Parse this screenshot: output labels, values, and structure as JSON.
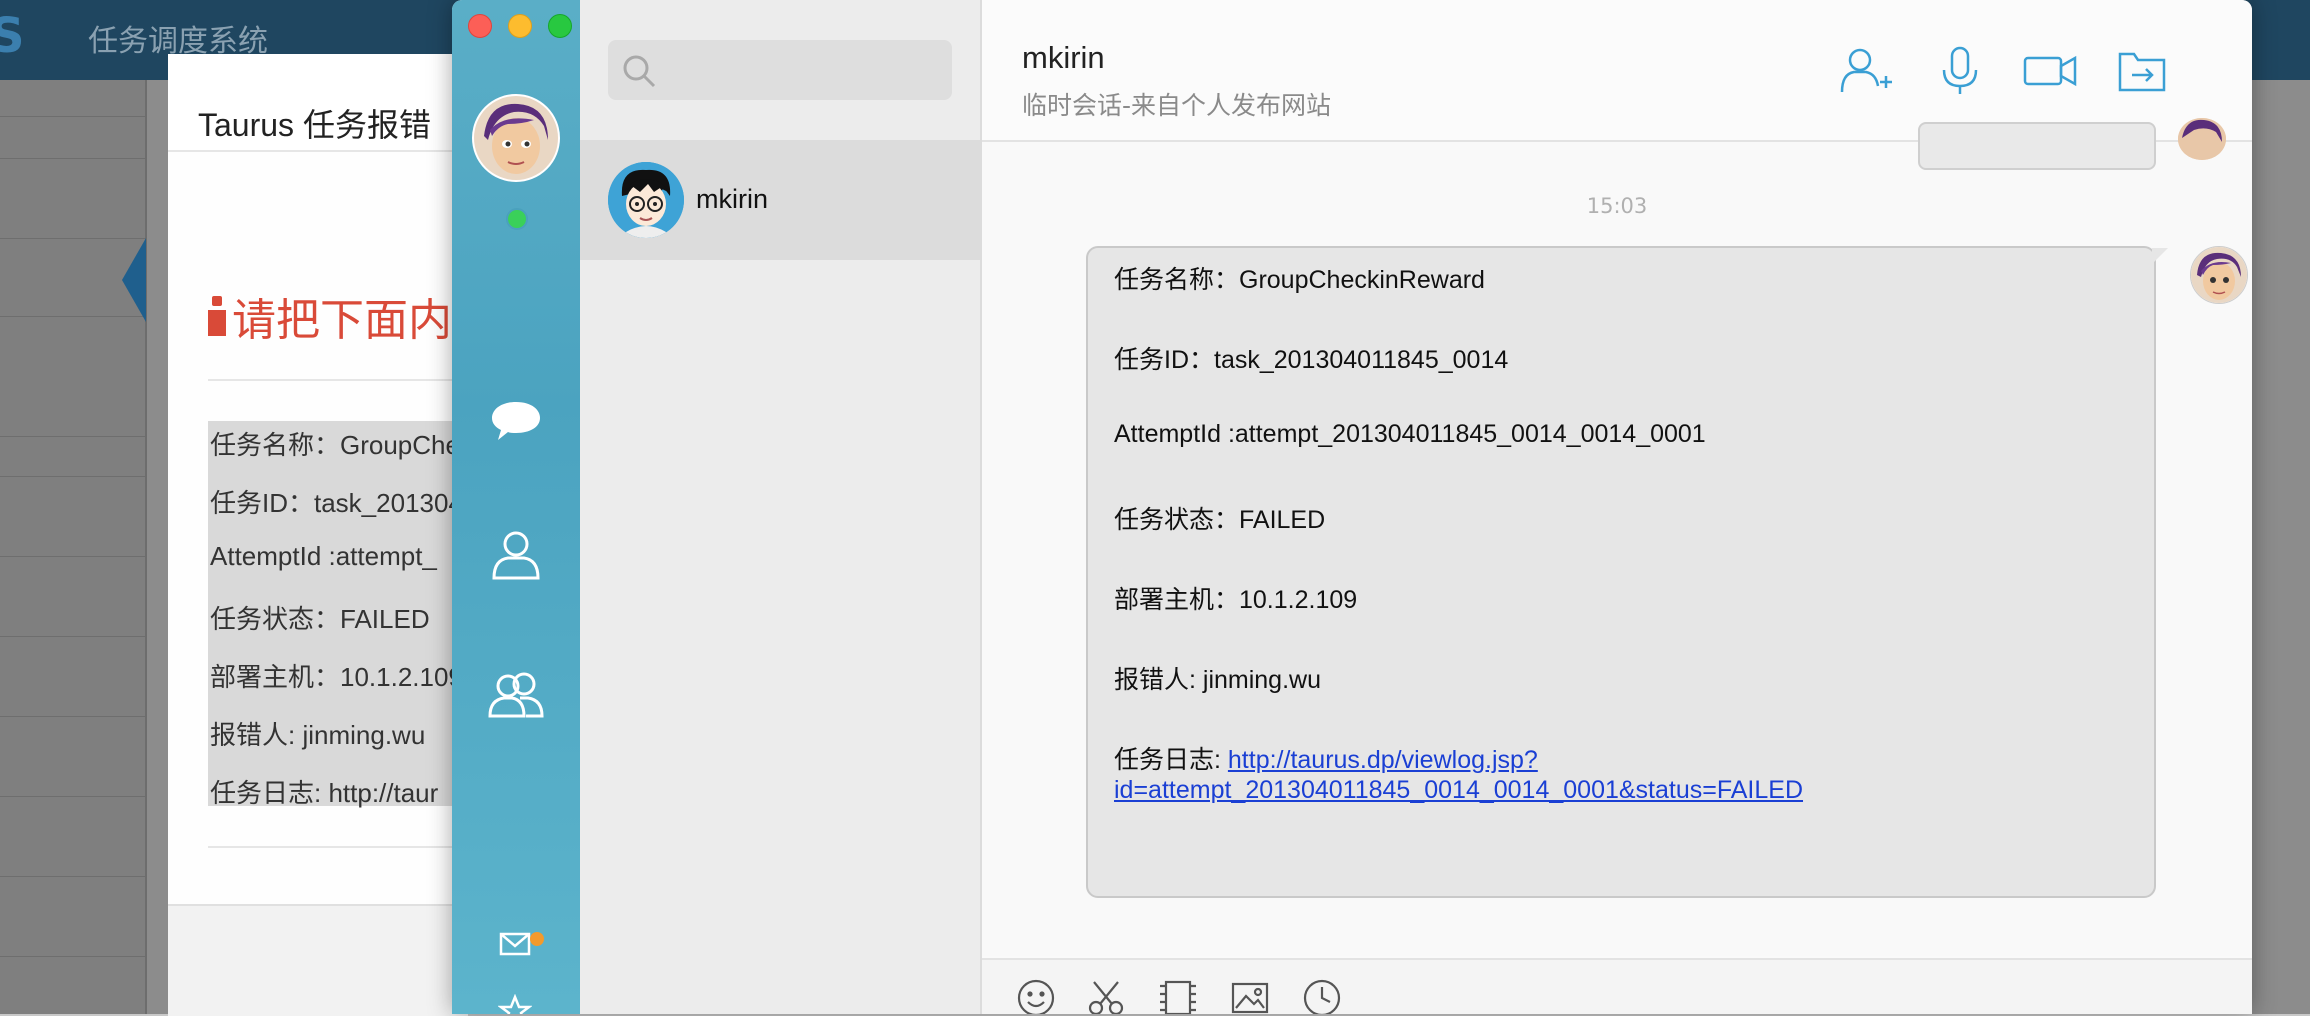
{
  "background_app": {
    "logo_letter": "S",
    "title": "任务调度系统"
  },
  "modal": {
    "title": "Taurus 任务报错",
    "warning": "请把下面内容",
    "lines": [
      "任务名称：GroupChe",
      "任务ID：task_201304",
      "AttemptId :attempt_",
      "任务状态：FAILED",
      "部署主机：10.1.2.109",
      "报错人: jinming.wu",
      "任务日志: http://taur"
    ]
  },
  "chat_app": {
    "search": {
      "placeholder": ""
    },
    "conversations": [
      {
        "name": "mkirin"
      }
    ],
    "header": {
      "name": "mkirin",
      "subtitle": "临时会话-来自个人发布网站"
    },
    "timestamp": "15:03",
    "message": {
      "task_name": "任务名称：GroupCheckinReward",
      "task_id": "任务ID：task_201304011845_0014",
      "attempt_id": "AttemptId :attempt_201304011845_0014_0014_0001",
      "status": "任务状态：FAILED",
      "host": "部署主机：10.1.2.109",
      "reporter": "报错人: jinming.wu",
      "log_label": "任务日志: ",
      "log_link_line1": "http://taurus.dp/viewlog.jsp?",
      "log_link_line2": "id=attempt_201304011845_0014_0014_0001&status=FAILED"
    }
  },
  "colors": {
    "nav_blue": "#4ba3c0",
    "accent_icon": "#3a9fd4",
    "warning_red": "#d94a38",
    "link_blue": "#1a3fd4",
    "online_green": "#3ad05a",
    "notification_orange": "#f39a2c"
  }
}
